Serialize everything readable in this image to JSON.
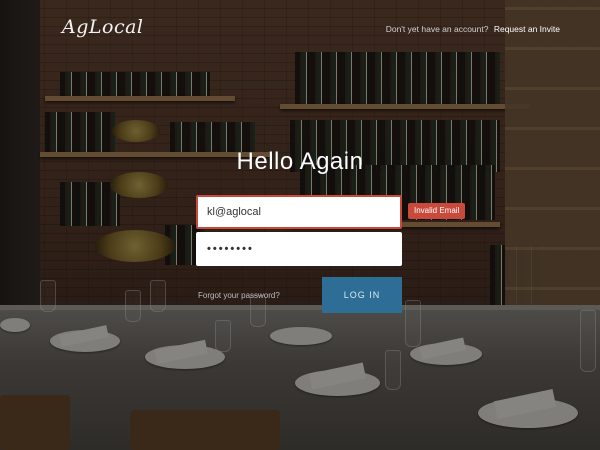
{
  "header": {
    "logo_text": "AgLocal",
    "signup_prompt": "Don't yet have an account?",
    "signup_link": "Request an Invite"
  },
  "login": {
    "title": "Hello Again",
    "email_value": "kl@aglocal",
    "email_error": "Invalid Email",
    "password_value": "••••••••",
    "forgot_link": "Forgot your password?",
    "login_button": "LOG IN"
  },
  "colors": {
    "error": "#c94a3b",
    "button": "#2e6e96"
  }
}
